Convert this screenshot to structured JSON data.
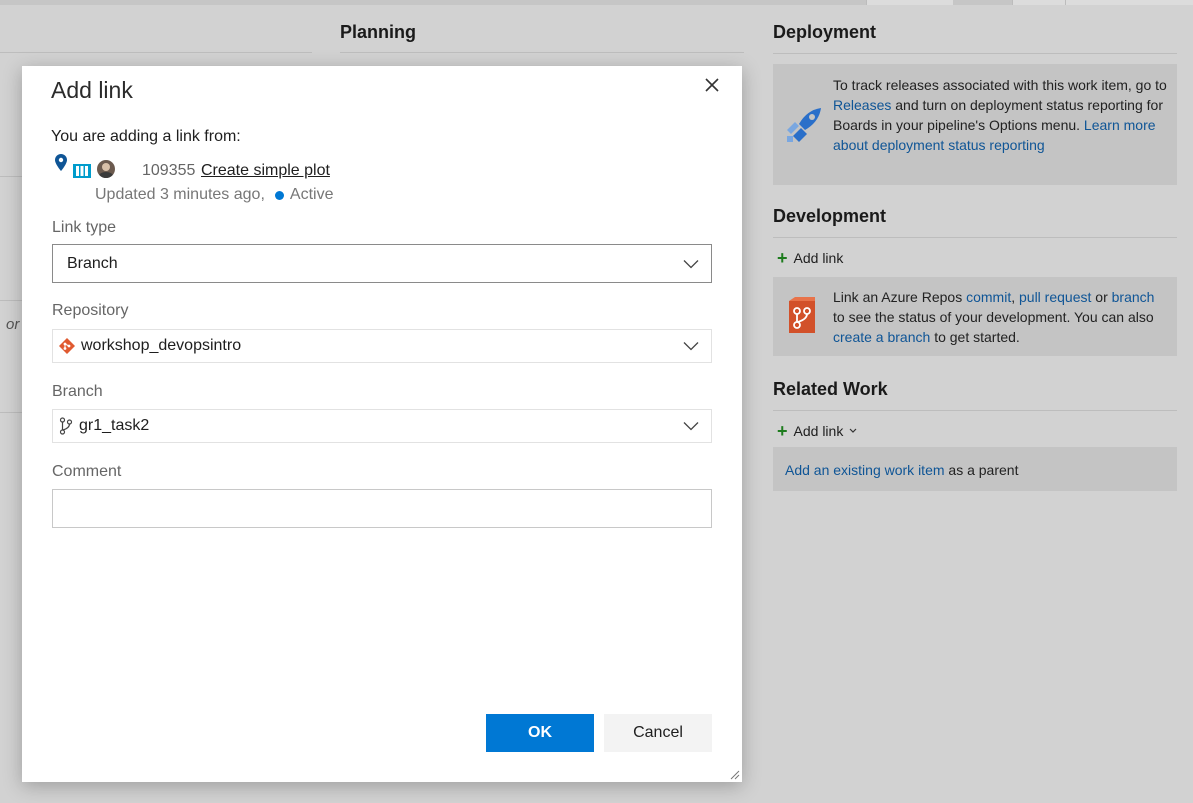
{
  "background": {
    "planning_heading": "Planning",
    "or_text": "or",
    "deployment": {
      "heading": "Deployment",
      "text_1": "To track releases associated with this work item, go to",
      "releases_link": "Releases",
      "text_2": "and turn on deployment status reporting for Boards in your pipeline's Options menu.",
      "learn_more_link": "Learn more about deployment status reporting"
    },
    "development": {
      "heading": "Development",
      "add_link_label": "Add link",
      "text_1": "Link an Azure Repos",
      "commit_link": "commit",
      "comma": ",",
      "pull_request_link": "pull request",
      "or": "or",
      "branch_link": "branch",
      "text_2": "to see the status of your development. You can also",
      "create_branch_link": "create a branch",
      "text_3": "to get started."
    },
    "related_work": {
      "heading": "Related Work",
      "add_link_label": "Add link",
      "existing_item_link": "Add an existing work item",
      "as_parent_text": "as a parent"
    }
  },
  "dialog": {
    "title": "Add link",
    "adding_from_label": "You are adding a link from:",
    "work_item": {
      "id": "109355",
      "title": "Create simple plot",
      "updated": "Updated 3 minutes ago,",
      "state": "Active"
    },
    "link_type": {
      "label": "Link type",
      "value": "Branch"
    },
    "repository": {
      "label": "Repository",
      "value": "workshop_devopsintro"
    },
    "branch": {
      "label": "Branch",
      "value": "gr1_task2"
    },
    "comment": {
      "label": "Comment",
      "value": ""
    },
    "ok_label": "OK",
    "cancel_label": "Cancel"
  },
  "colors": {
    "primary": "#0078d4",
    "link": "#0f5596",
    "state_active": "#0078d4",
    "repo_icon": "#e05a30"
  }
}
